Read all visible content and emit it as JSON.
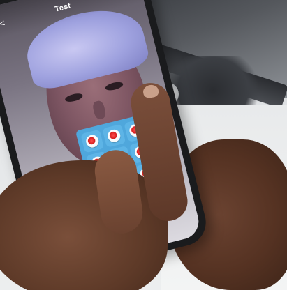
{
  "app": {
    "title": "Test",
    "back_label": "<"
  },
  "button_grid": {
    "rows": 3,
    "columns": 3,
    "button_color": "#5db4e6",
    "dot_color": "#e02020",
    "buttons": [
      {
        "icon": "record-dot-icon"
      },
      {
        "icon": "record-dot-icon"
      },
      {
        "icon": "record-dot-icon"
      },
      {
        "icon": "record-dot-icon"
      },
      {
        "icon": "record-dot-icon"
      },
      {
        "icon": "record-dot-icon"
      },
      {
        "icon": "record-dot-icon"
      },
      {
        "icon": "record-dot-icon"
      },
      {
        "icon": "record-dot-icon"
      }
    ]
  },
  "colors": {
    "overlay_blue": "#4fa7dc",
    "phone_body": "#1a1b1d"
  }
}
